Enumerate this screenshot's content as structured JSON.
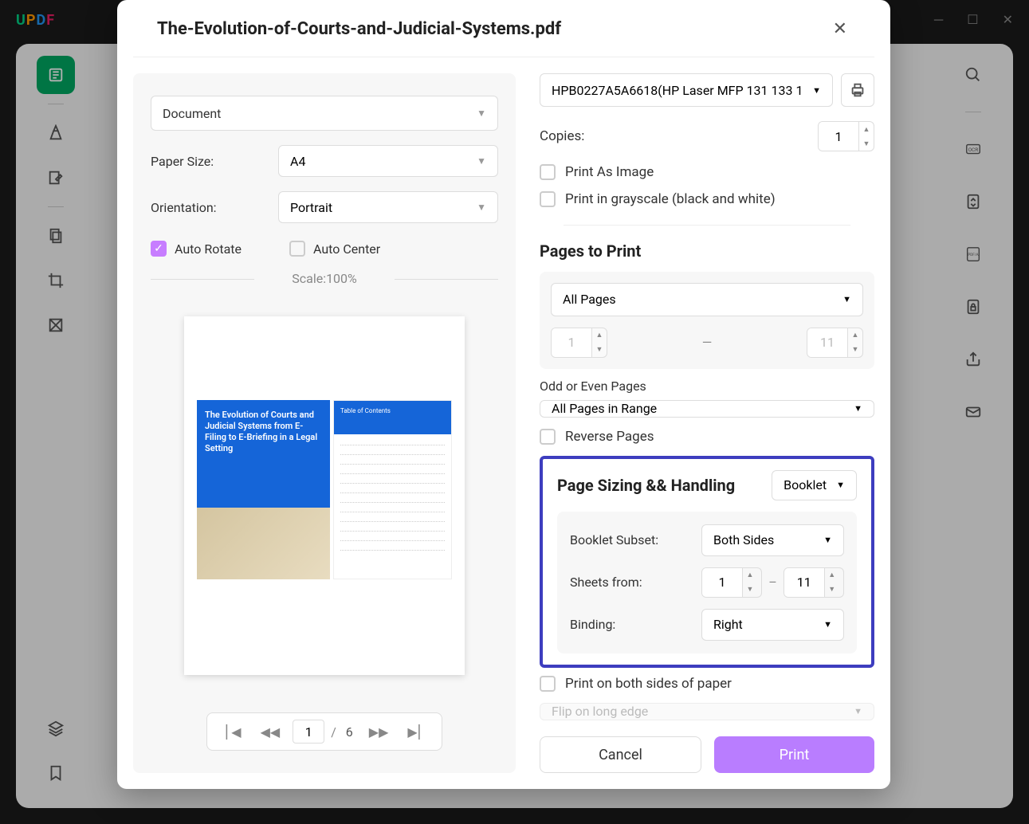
{
  "app": {
    "logo": "UPDF"
  },
  "modal": {
    "title": "The-Evolution-of-Courts-and-Judicial-Systems.pdf",
    "left": {
      "mode": "Document",
      "paper_size_label": "Paper Size:",
      "paper_size": "A4",
      "orientation_label": "Orientation:",
      "orientation": "Portrait",
      "auto_rotate": "Auto Rotate",
      "auto_center": "Auto Center",
      "scale": "Scale:100%",
      "preview_title": "The Evolution of Courts and Judicial Systems from E-Filing to E-Briefing in a Legal Setting",
      "preview_toc": "Table of Contents",
      "pager": {
        "current": "1",
        "sep": "/",
        "total": "6"
      }
    },
    "right": {
      "printer": "HPB0227A5A6618(HP Laser MFP 131 133 1",
      "copies_label": "Copies:",
      "copies": "1",
      "print_as_image": "Print As Image",
      "print_grayscale": "Print in grayscale (black and white)",
      "pages_to_print": "Pages to Print",
      "page_range": "All Pages",
      "range_from": "1",
      "range_to": "11",
      "odd_even_label": "Odd or Even Pages",
      "odd_even": "All Pages in Range",
      "reverse_pages": "Reverse Pages",
      "page_sizing": "Page Sizing && Handling",
      "sizing_mode": "Booklet",
      "booklet_subset_label": "Booklet Subset:",
      "booklet_subset": "Both Sides",
      "sheets_from_label": "Sheets from:",
      "sheets_from": "1",
      "sheets_to": "11",
      "binding_label": "Binding:",
      "binding": "Right",
      "print_both_sides": "Print on both sides of paper",
      "flip": "Flip on long edge",
      "cancel": "Cancel",
      "print": "Print"
    }
  }
}
